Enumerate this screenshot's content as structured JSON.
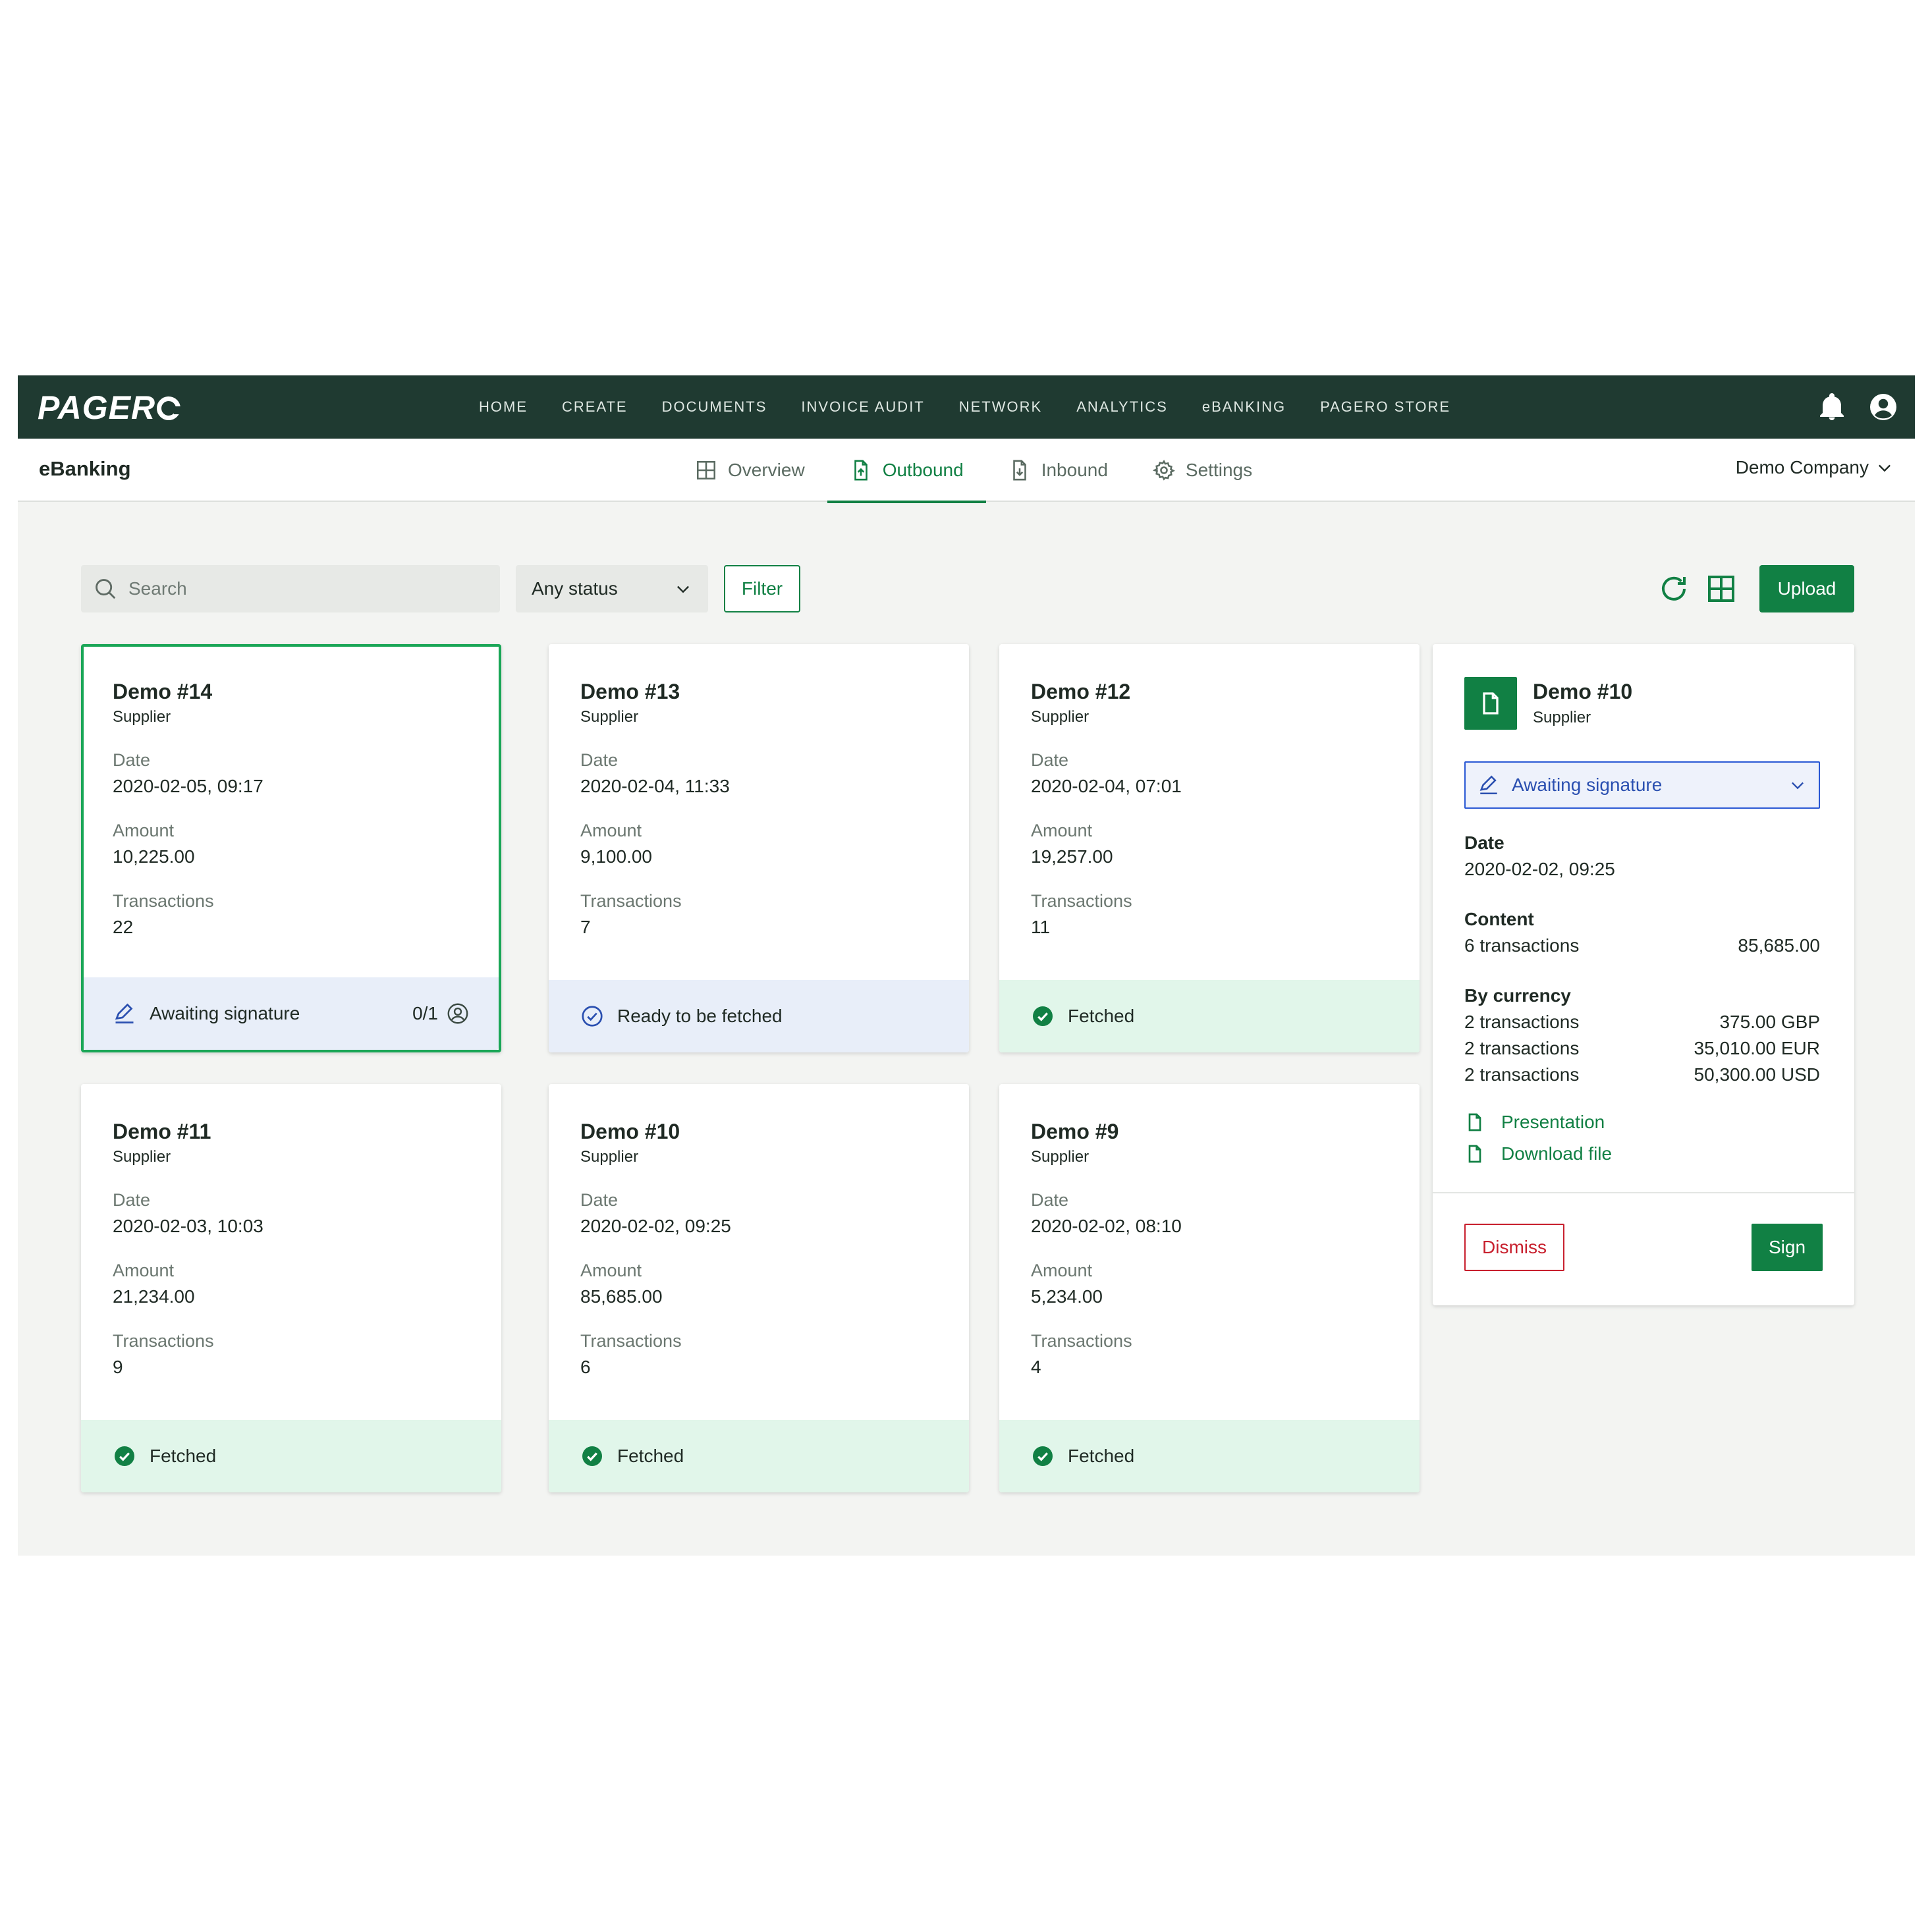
{
  "brand": {
    "logo": "PAGER",
    "primary": "#118044",
    "dark": "#1f3a31"
  },
  "nav": [
    "HOME",
    "CREATE",
    "DOCUMENTS",
    "INVOICE AUDIT",
    "NETWORK",
    "ANALYTICS",
    "eBANKING",
    "PAGERO STORE"
  ],
  "top_icons": [
    "bell-icon",
    "user-icon"
  ],
  "subheader": {
    "title": "eBanking",
    "tabs": [
      {
        "label": "Overview",
        "icon": "grid-icon"
      },
      {
        "label": "Outbound",
        "icon": "file-upload-icon",
        "active": true
      },
      {
        "label": "Inbound",
        "icon": "file-download-icon"
      },
      {
        "label": "Settings",
        "icon": "gear-icon"
      }
    ],
    "company": "Demo Company"
  },
  "toolbar": {
    "search_placeholder": "Search",
    "status_value": "Any status",
    "filter_label": "Filter",
    "upload_label": "Upload"
  },
  "labels": {
    "date": "Date",
    "amount": "Amount",
    "transactions": "Transactions"
  },
  "cards": [
    {
      "title": "Demo #14",
      "sub": "Supplier",
      "date": "2020-02-05, 09:17",
      "amount": "10,225.00",
      "transactions": "22",
      "status": "Awaiting signature",
      "status_kind": "awaiting",
      "signers": "0/1",
      "selected": true
    },
    {
      "title": "Demo #13",
      "sub": "Supplier",
      "date": "2020-02-04, 11:33",
      "amount": "9,100.00",
      "transactions": "7",
      "status": "Ready to be fetched",
      "status_kind": "ready"
    },
    {
      "title": "Demo #12",
      "sub": "Supplier",
      "date": "2020-02-04, 07:01",
      "amount": "19,257.00",
      "transactions": "11",
      "status": "Fetched",
      "status_kind": "fetched"
    },
    {
      "title": "Demo #11",
      "sub": "Supplier",
      "date": "2020-02-03, 10:03",
      "amount": "21,234.00",
      "transactions": "9",
      "status": "Fetched",
      "status_kind": "fetched"
    },
    {
      "title": "Demo #10",
      "sub": "Supplier",
      "date": "2020-02-02, 09:25",
      "amount": "85,685.00",
      "transactions": "6",
      "status": "Fetched",
      "status_kind": "fetched"
    },
    {
      "title": "Demo #9",
      "sub": "Supplier",
      "date": "2020-02-02, 08:10",
      "amount": "5,234.00",
      "transactions": "4",
      "status": "Fetched",
      "status_kind": "fetched"
    }
  ],
  "detail": {
    "title": "Demo #10",
    "sub": "Supplier",
    "status": "Awaiting signature",
    "date_label": "Date",
    "date": "2020-02-02, 09:25",
    "content_label": "Content",
    "content": {
      "left": "6 transactions",
      "right": "85,685.00"
    },
    "by_currency_label": "By currency",
    "currencies": [
      {
        "left": "2 transactions",
        "right": "375.00 GBP"
      },
      {
        "left": "2 transactions",
        "right": "35,010.00 EUR"
      },
      {
        "left": "2 transactions",
        "right": "50,300.00 USD"
      }
    ],
    "links": [
      "Presentation",
      "Download file"
    ],
    "dismiss_label": "Dismiss",
    "sign_label": "Sign"
  }
}
